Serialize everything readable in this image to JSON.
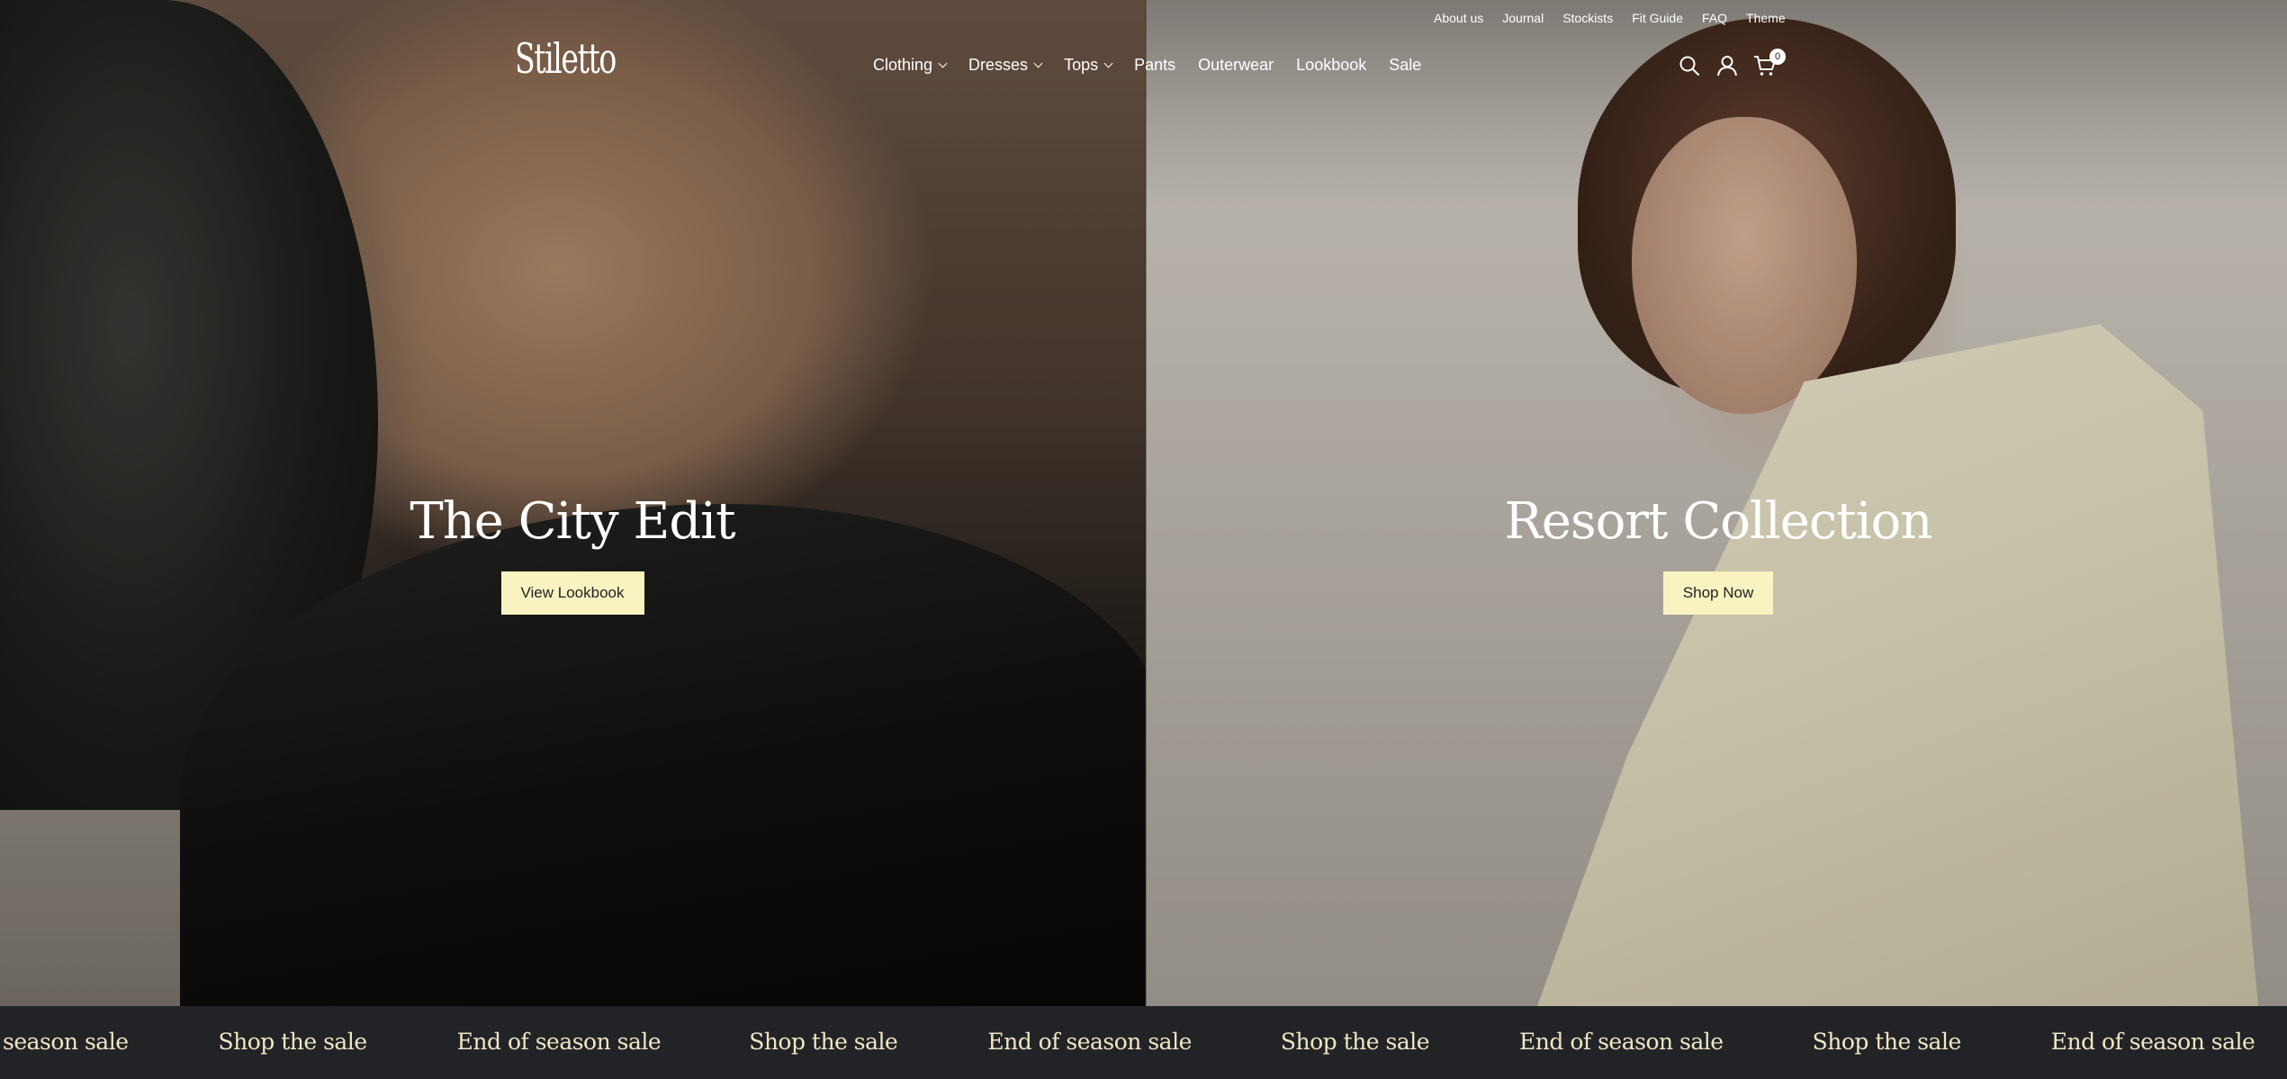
{
  "header": {
    "logo": "Stiletto",
    "top_links": [
      "About us",
      "Journal",
      "Stockists",
      "Fit Guide",
      "FAQ",
      "Theme"
    ],
    "nav": [
      {
        "label": "Clothing",
        "dropdown": true
      },
      {
        "label": "Dresses",
        "dropdown": true
      },
      {
        "label": "Tops",
        "dropdown": true
      },
      {
        "label": "Pants",
        "dropdown": false
      },
      {
        "label": "Outerwear",
        "dropdown": false
      },
      {
        "label": "Lookbook",
        "dropdown": false
      },
      {
        "label": "Sale",
        "dropdown": false
      }
    ],
    "icons": [
      "search-icon",
      "account-icon",
      "cart-icon"
    ],
    "cart_count": "0"
  },
  "hero": {
    "left": {
      "title": "The City Edit",
      "button": "View Lookbook"
    },
    "right": {
      "title": "Resort Collection",
      "button": "Shop Now"
    }
  },
  "marquee": {
    "items": [
      "season sale",
      "Shop the sale",
      "End of season sale",
      "Shop the sale",
      "End of season sale",
      "Shop the sale",
      "End of season sale",
      "Shop the sale",
      "End of season sale",
      "Shop the sale"
    ]
  },
  "colors": {
    "button_bg": "#f8f3c0",
    "marquee_bg": "#222326",
    "marquee_text": "#efe6c4"
  }
}
